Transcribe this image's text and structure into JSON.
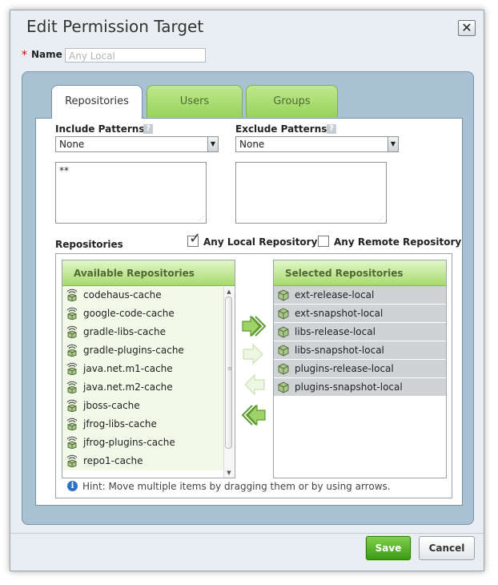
{
  "dialog": {
    "title": "Edit Permission Target",
    "close_label": "✕"
  },
  "name_field": {
    "required_marker": "*",
    "label": "Name",
    "value": "Any Local"
  },
  "tabs": [
    {
      "label": "Repositories",
      "active": true
    },
    {
      "label": "Users",
      "active": false
    },
    {
      "label": "Groups",
      "active": false
    }
  ],
  "include": {
    "label": "Include Patterns",
    "help": "?",
    "select_value": "None",
    "patterns": "**"
  },
  "exclude": {
    "label": "Exclude Patterns",
    "help": "?",
    "select_value": "None",
    "patterns": ""
  },
  "repositories": {
    "label": "Repositories",
    "any_local": {
      "label": "Any Local Repository",
      "checked": true
    },
    "any_remote": {
      "label": "Any Remote Repository",
      "checked": false
    },
    "available_header": "Available Repositories",
    "available": [
      "codehaus-cache",
      "google-code-cache",
      "gradle-libs-cache",
      "gradle-plugins-cache",
      "java.net.m1-cache",
      "java.net.m2-cache",
      "jboss-cache",
      "jfrog-libs-cache",
      "jfrog-plugins-cache",
      "repo1-cache"
    ],
    "selected_header": "Selected Repositories",
    "selected": [
      "ext-release-local",
      "ext-snapshot-local",
      "libs-release-local",
      "libs-snapshot-local",
      "plugins-release-local",
      "plugins-snapshot-local"
    ],
    "hint_icon": "i",
    "hint": "Hint: Move multiple items by dragging them or by using arrows."
  },
  "buttons": {
    "save": "Save",
    "cancel": "Cancel"
  },
  "colors": {
    "accent_green": "#97d35b",
    "panel_blue": "#a9c2d3",
    "save_green": "#3d9a16"
  }
}
